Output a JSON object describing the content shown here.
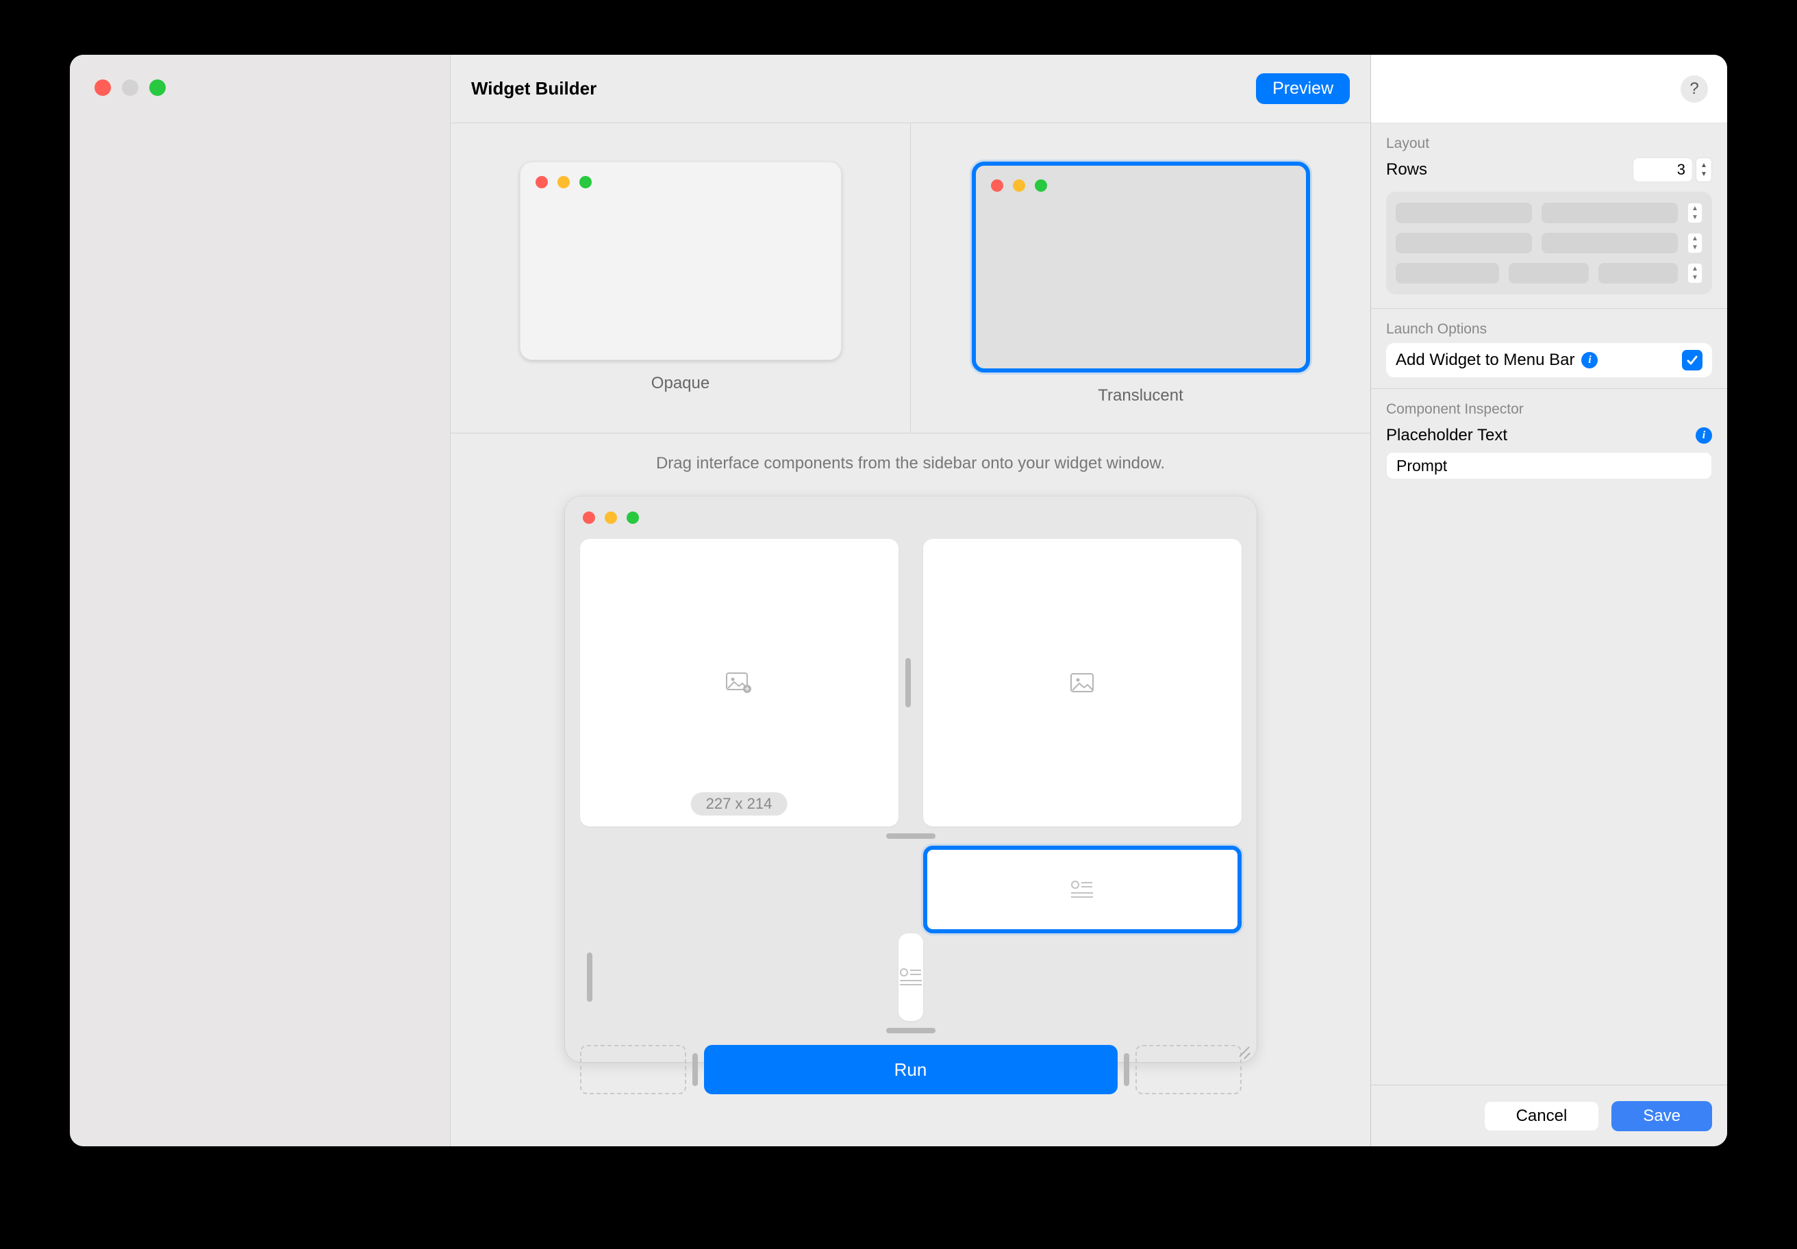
{
  "header": {
    "title": "Widget Builder",
    "preview": "Preview"
  },
  "styles": {
    "opaque": "Opaque",
    "translucent": "Translucent"
  },
  "canvas": {
    "hint": "Drag interface components from the sidebar onto your widget window.",
    "size_badge": "227 x 214",
    "run": "Run"
  },
  "inspector": {
    "help": "?",
    "layout_label": "Layout",
    "rows_label": "Rows",
    "rows_value": "3",
    "launch_label": "Launch Options",
    "launch_option": "Add Widget to Menu Bar",
    "component_label": "Component Inspector",
    "placeholder_label": "Placeholder Text",
    "placeholder_value": "Prompt",
    "cancel": "Cancel",
    "save": "Save"
  }
}
